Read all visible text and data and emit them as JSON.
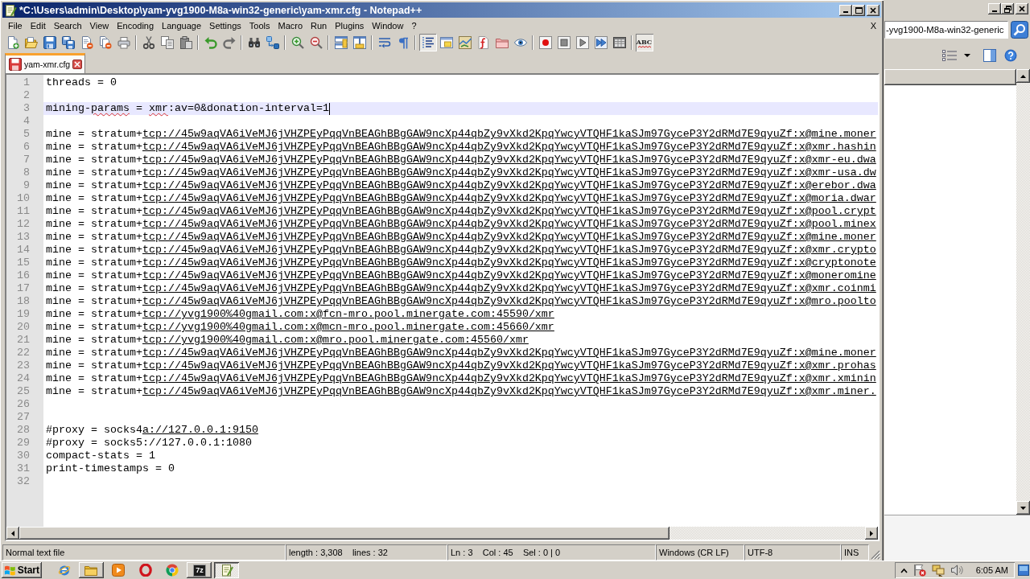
{
  "window": {
    "title": "*C:\\Users\\admin\\Desktop\\yam-yvg1900-M8a-win32-generic\\yam-xmr.cfg - Notepad++"
  },
  "menu": {
    "items": [
      "File",
      "Edit",
      "Search",
      "View",
      "Encoding",
      "Language",
      "Settings",
      "Tools",
      "Macro",
      "Run",
      "Plugins",
      "Window",
      "?"
    ],
    "close_label": "X"
  },
  "toolbar": [
    [
      {
        "kind": "new",
        "pressed": false
      },
      {
        "kind": "open",
        "pressed": false
      },
      {
        "kind": "save",
        "pressed": false
      },
      {
        "kind": "saveall",
        "pressed": false
      },
      {
        "kind": "close",
        "pressed": false
      },
      {
        "kind": "closeall",
        "pressed": false
      },
      {
        "kind": "print",
        "pressed": false
      }
    ],
    [
      {
        "kind": "cut",
        "pressed": false
      },
      {
        "kind": "copy",
        "pressed": false
      },
      {
        "kind": "paste",
        "pressed": false
      }
    ],
    [
      {
        "kind": "undo",
        "pressed": false
      },
      {
        "kind": "redo",
        "pressed": false
      }
    ],
    [
      {
        "kind": "find",
        "pressed": false
      },
      {
        "kind": "replace",
        "pressed": false
      }
    ],
    [
      {
        "kind": "zoomin",
        "pressed": false
      },
      {
        "kind": "zoomout",
        "pressed": false
      }
    ],
    [
      {
        "kind": "syncv",
        "pressed": false
      },
      {
        "kind": "synch",
        "pressed": false
      }
    ],
    [
      {
        "kind": "wrap",
        "pressed": false
      },
      {
        "kind": "allchars",
        "pressed": false
      }
    ],
    [
      {
        "kind": "indent",
        "pressed": true
      },
      {
        "kind": "udl",
        "pressed": false
      },
      {
        "kind": "docmap",
        "pressed": false
      },
      {
        "kind": "funclist",
        "pressed": false
      },
      {
        "kind": "workspace",
        "pressed": false
      },
      {
        "kind": "monitor",
        "pressed": false
      }
    ],
    [
      {
        "kind": "record",
        "pressed": false
      },
      {
        "kind": "stop",
        "pressed": false
      },
      {
        "kind": "play",
        "pressed": false
      },
      {
        "kind": "playmulti",
        "pressed": false
      },
      {
        "kind": "savemacro",
        "pressed": false
      }
    ],
    [
      {
        "kind": "spell",
        "pressed": true,
        "label": "ABC"
      }
    ]
  ],
  "tabs": [
    {
      "label": "yam-xmr.cfg",
      "selected": true,
      "modified": true
    }
  ],
  "editor": {
    "lines": [
      {
        "number": "1",
        "current": false,
        "segments": [
          {
            "kind": "text",
            "text": "threads = 0"
          }
        ]
      },
      {
        "number": "2",
        "current": false
      },
      {
        "number": "3",
        "current": true,
        "segments": [
          {
            "kind": "text",
            "text": "mining-"
          },
          {
            "kind": "misspelled",
            "text": "params"
          },
          {
            "kind": "text",
            "text": " = "
          },
          {
            "kind": "misspelled",
            "text": "xmr"
          },
          {
            "kind": "text",
            "text": ":av=0&donation-interval=1"
          }
        ]
      },
      {
        "number": "4",
        "current": false
      },
      {
        "number": "5",
        "current": false,
        "segments": [
          {
            "kind": "text",
            "text": "mine = stratum+"
          },
          {
            "kind": "link",
            "text": "tcp://45w9aqVA6iVeMJ6jVHZPEyPqqVnBEAGhBBgGAW9ncXp44qbZy9vXkd2KpqYwcyVTQHF1kaSJm97GyceP3Y2dRMd7E9qyuZf:x@mine.moner"
          }
        ]
      },
      {
        "number": "6",
        "current": false,
        "segments": [
          {
            "kind": "text",
            "text": "mine = stratum+"
          },
          {
            "kind": "link",
            "text": "tcp://45w9aqVA6iVeMJ6jVHZPEyPqqVnBEAGhBBgGAW9ncXp44qbZy9vXkd2KpqYwcyVTQHF1kaSJm97GyceP3Y2dRMd7E9qyuZf:x@xmr.hashin"
          }
        ]
      },
      {
        "number": "7",
        "current": false,
        "segments": [
          {
            "kind": "text",
            "text": "mine = stratum+"
          },
          {
            "kind": "link",
            "text": "tcp://45w9aqVA6iVeMJ6jVHZPEyPqqVnBEAGhBBgGAW9ncXp44qbZy9vXkd2KpqYwcyVTQHF1kaSJm97GyceP3Y2dRMd7E9qyuZf:x@xmr-eu.dwa"
          }
        ]
      },
      {
        "number": "8",
        "current": false,
        "segments": [
          {
            "kind": "text",
            "text": "mine = stratum+"
          },
          {
            "kind": "link",
            "text": "tcp://45w9aqVA6iVeMJ6jVHZPEyPqqVnBEAGhBBgGAW9ncXp44qbZy9vXkd2KpqYwcyVTQHF1kaSJm97GyceP3Y2dRMd7E9qyuZf:x@xmr-usa.dw"
          }
        ]
      },
      {
        "number": "9",
        "current": false,
        "segments": [
          {
            "kind": "text",
            "text": "mine = stratum+"
          },
          {
            "kind": "link",
            "text": "tcp://45w9aqVA6iVeMJ6jVHZPEyPqqVnBEAGhBBgGAW9ncXp44qbZy9vXkd2KpqYwcyVTQHF1kaSJm97GyceP3Y2dRMd7E9qyuZf:x@erebor.dwa"
          }
        ]
      },
      {
        "number": "10",
        "current": false,
        "segments": [
          {
            "kind": "text",
            "text": "mine = stratum+"
          },
          {
            "kind": "link",
            "text": "tcp://45w9aqVA6iVeMJ6jVHZPEyPqqVnBEAGhBBgGAW9ncXp44qbZy9vXkd2KpqYwcyVTQHF1kaSJm97GyceP3Y2dRMd7E9qyuZf:x@moria.dwar"
          }
        ]
      },
      {
        "number": "11",
        "current": false,
        "segments": [
          {
            "kind": "text",
            "text": "mine = stratum+"
          },
          {
            "kind": "link",
            "text": "tcp://45w9aqVA6iVeMJ6jVHZPEyPqqVnBEAGhBBgGAW9ncXp44qbZy9vXkd2KpqYwcyVTQHF1kaSJm97GyceP3Y2dRMd7E9qyuZf:x@pool.crypt"
          }
        ]
      },
      {
        "number": "12",
        "current": false,
        "segments": [
          {
            "kind": "text",
            "text": "mine = stratum+"
          },
          {
            "kind": "link",
            "text": "tcp://45w9aqVA6iVeMJ6jVHZPEyPqqVnBEAGhBBgGAW9ncXp44qbZy9vXkd2KpqYwcyVTQHF1kaSJm97GyceP3Y2dRMd7E9qyuZf:x@pool.minex"
          }
        ]
      },
      {
        "number": "13",
        "current": false,
        "segments": [
          {
            "kind": "text",
            "text": "mine = stratum+"
          },
          {
            "kind": "link",
            "text": "tcp://45w9aqVA6iVeMJ6jVHZPEyPqqVnBEAGhBBgGAW9ncXp44qbZy9vXkd2KpqYwcyVTQHF1kaSJm97GyceP3Y2dRMd7E9qyuZf:x@mine.moner"
          }
        ]
      },
      {
        "number": "14",
        "current": false,
        "segments": [
          {
            "kind": "text",
            "text": "mine = stratum+"
          },
          {
            "kind": "link",
            "text": "tcp://45w9aqVA6iVeMJ6jVHZPEyPqqVnBEAGhBBgGAW9ncXp44qbZy9vXkd2KpqYwcyVTQHF1kaSJm97GyceP3Y2dRMd7E9qyuZf:x@xmr.crypto"
          }
        ]
      },
      {
        "number": "15",
        "current": false,
        "segments": [
          {
            "kind": "text",
            "text": "mine = stratum+"
          },
          {
            "kind": "link",
            "text": "tcp://45w9aqVA6iVeMJ6jVHZPEyPqqVnBEAGhBBgGAW9ncXp44qbZy9vXkd2KpqYwcyVTQHF1kaSJm97GyceP3Y2dRMd7E9qyuZf:x@cryptonote"
          }
        ]
      },
      {
        "number": "16",
        "current": false,
        "segments": [
          {
            "kind": "text",
            "text": "mine = stratum+"
          },
          {
            "kind": "link",
            "text": "tcp://45w9aqVA6iVeMJ6jVHZPEyPqqVnBEAGhBBgGAW9ncXp44qbZy9vXkd2KpqYwcyVTQHF1kaSJm97GyceP3Y2dRMd7E9qyuZf:x@moneromine"
          }
        ]
      },
      {
        "number": "17",
        "current": false,
        "segments": [
          {
            "kind": "text",
            "text": "mine = stratum+"
          },
          {
            "kind": "link",
            "text": "tcp://45w9aqVA6iVeMJ6jVHZPEyPqqVnBEAGhBBgGAW9ncXp44qbZy9vXkd2KpqYwcyVTQHF1kaSJm97GyceP3Y2dRMd7E9qyuZf:x@xmr.coinmi"
          }
        ]
      },
      {
        "number": "18",
        "current": false,
        "segments": [
          {
            "kind": "text",
            "text": "mine = stratum+"
          },
          {
            "kind": "link",
            "text": "tcp://45w9aqVA6iVeMJ6jVHZPEyPqqVnBEAGhBBgGAW9ncXp44qbZy9vXkd2KpqYwcyVTQHF1kaSJm97GyceP3Y2dRMd7E9qyuZf:x@mro.poolto"
          }
        ]
      },
      {
        "number": "19",
        "current": false,
        "segments": [
          {
            "kind": "text",
            "text": "mine = stratum+"
          },
          {
            "kind": "link",
            "text": "tcp://yvg1900%40gmail.com:x@fcn-mro.pool.minergate.com:45590/xmr"
          }
        ]
      },
      {
        "number": "20",
        "current": false,
        "segments": [
          {
            "kind": "text",
            "text": "mine = stratum+"
          },
          {
            "kind": "link",
            "text": "tcp://yvg1900%40gmail.com:x@mcn-mro.pool.minergate.com:45660/xmr"
          }
        ]
      },
      {
        "number": "21",
        "current": false,
        "segments": [
          {
            "kind": "text",
            "text": "mine = stratum+"
          },
          {
            "kind": "link",
            "text": "tcp://yvg1900%40gmail.com:x@mro.pool.minergate.com:45560/xmr"
          }
        ]
      },
      {
        "number": "22",
        "current": false,
        "segments": [
          {
            "kind": "text",
            "text": "mine = stratum+"
          },
          {
            "kind": "link",
            "text": "tcp://45w9aqVA6iVeMJ6jVHZPEyPqqVnBEAGhBBgGAW9ncXp44qbZy9vXkd2KpqYwcyVTQHF1kaSJm97GyceP3Y2dRMd7E9qyuZf:x@mine.moner"
          }
        ]
      },
      {
        "number": "23",
        "current": false,
        "segments": [
          {
            "kind": "text",
            "text": "mine = stratum+"
          },
          {
            "kind": "link",
            "text": "tcp://45w9aqVA6iVeMJ6jVHZPEyPqqVnBEAGhBBgGAW9ncXp44qbZy9vXkd2KpqYwcyVTQHF1kaSJm97GyceP3Y2dRMd7E9qyuZf:x@xmr.prohas"
          }
        ]
      },
      {
        "number": "24",
        "current": false,
        "segments": [
          {
            "kind": "text",
            "text": "mine = stratum+"
          },
          {
            "kind": "link",
            "text": "tcp://45w9aqVA6iVeMJ6jVHZPEyPqqVnBEAGhBBgGAW9ncXp44qbZy9vXkd2KpqYwcyVTQHF1kaSJm97GyceP3Y2dRMd7E9qyuZf:x@xmr.xminin"
          }
        ]
      },
      {
        "number": "25",
        "current": false,
        "segments": [
          {
            "kind": "text",
            "text": "mine = stratum+"
          },
          {
            "kind": "link",
            "text": "tcp://45w9aqVA6iVeMJ6jVHZPEyPqqVnBEAGhBBgGAW9ncXp44qbZy9vXkd2KpqYwcyVTQHF1kaSJm97GyceP3Y2dRMd7E9qyuZf:x@xmr.miner."
          }
        ]
      },
      {
        "number": "26",
        "current": false
      },
      {
        "number": "27",
        "current": false
      },
      {
        "number": "28",
        "current": false,
        "segments": [
          {
            "kind": "text",
            "text": "#proxy = socks4"
          },
          {
            "kind": "link",
            "text": "a://127.0.0.1:9150"
          }
        ]
      },
      {
        "number": "29",
        "current": false,
        "segments": [
          {
            "kind": "text",
            "text": "#proxy = socks5://127.0.0.1:1080"
          }
        ]
      },
      {
        "number": "30",
        "current": false,
        "segments": [
          {
            "kind": "text",
            "text": "compact-stats = 1"
          }
        ]
      },
      {
        "number": "31",
        "current": false,
        "segments": [
          {
            "kind": "text",
            "text": "print-timestamps = 0"
          }
        ]
      },
      {
        "number": "32",
        "current": false
      }
    ]
  },
  "status_bar": {
    "file_type": "Normal text file",
    "length": "length : 3,308    lines : 32",
    "position": "Ln : 3    Col : 45    Sel : 0 | 0",
    "line_ending": "Windows (CR LF)",
    "encoding": "UTF-8",
    "mode": "INS"
  },
  "background_window": {
    "address": "-yvg1900-M8a-win32-generic"
  },
  "taskbar": {
    "start": "Start",
    "apps": [
      {
        "kind": "globe",
        "open": false,
        "active": false
      },
      {
        "kind": "folder",
        "open": true,
        "active": false
      },
      {
        "kind": "player",
        "open": false,
        "active": false
      },
      {
        "kind": "ring",
        "open": false,
        "active": false
      },
      {
        "kind": "wheel",
        "open": false,
        "active": false
      },
      {
        "kind": "archive",
        "open": true,
        "active": false,
        "label": "7z"
      },
      {
        "kind": "notepad",
        "open": true,
        "active": true
      }
    ],
    "clock": "6:05 AM"
  }
}
